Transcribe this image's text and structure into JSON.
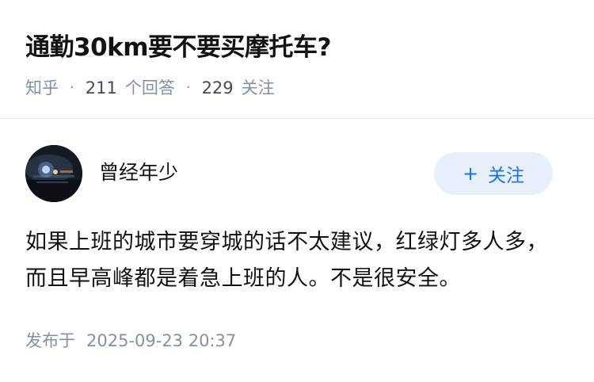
{
  "question": {
    "title": "通勤30km要不要买摩托车?",
    "source": "知乎",
    "answers_count": "211",
    "answers_unit": "个回答",
    "followers_count": "229",
    "followers_unit": "关注",
    "separator": "·"
  },
  "author": {
    "name": "曾经年少",
    "avatar_icon": "night-street-photo",
    "follow_label": "关注",
    "follow_icon": "plus-icon",
    "follow_color": "#1772f6",
    "follow_bg": "#e8f0fb"
  },
  "answer": {
    "text": "如果上班的城市要穿城的话不太建议，红绿灯多人多，而且早高峰都是着急上班的人。不是很安全。",
    "published_label": "发布于",
    "published_time": "2025-09-23 20:37"
  }
}
